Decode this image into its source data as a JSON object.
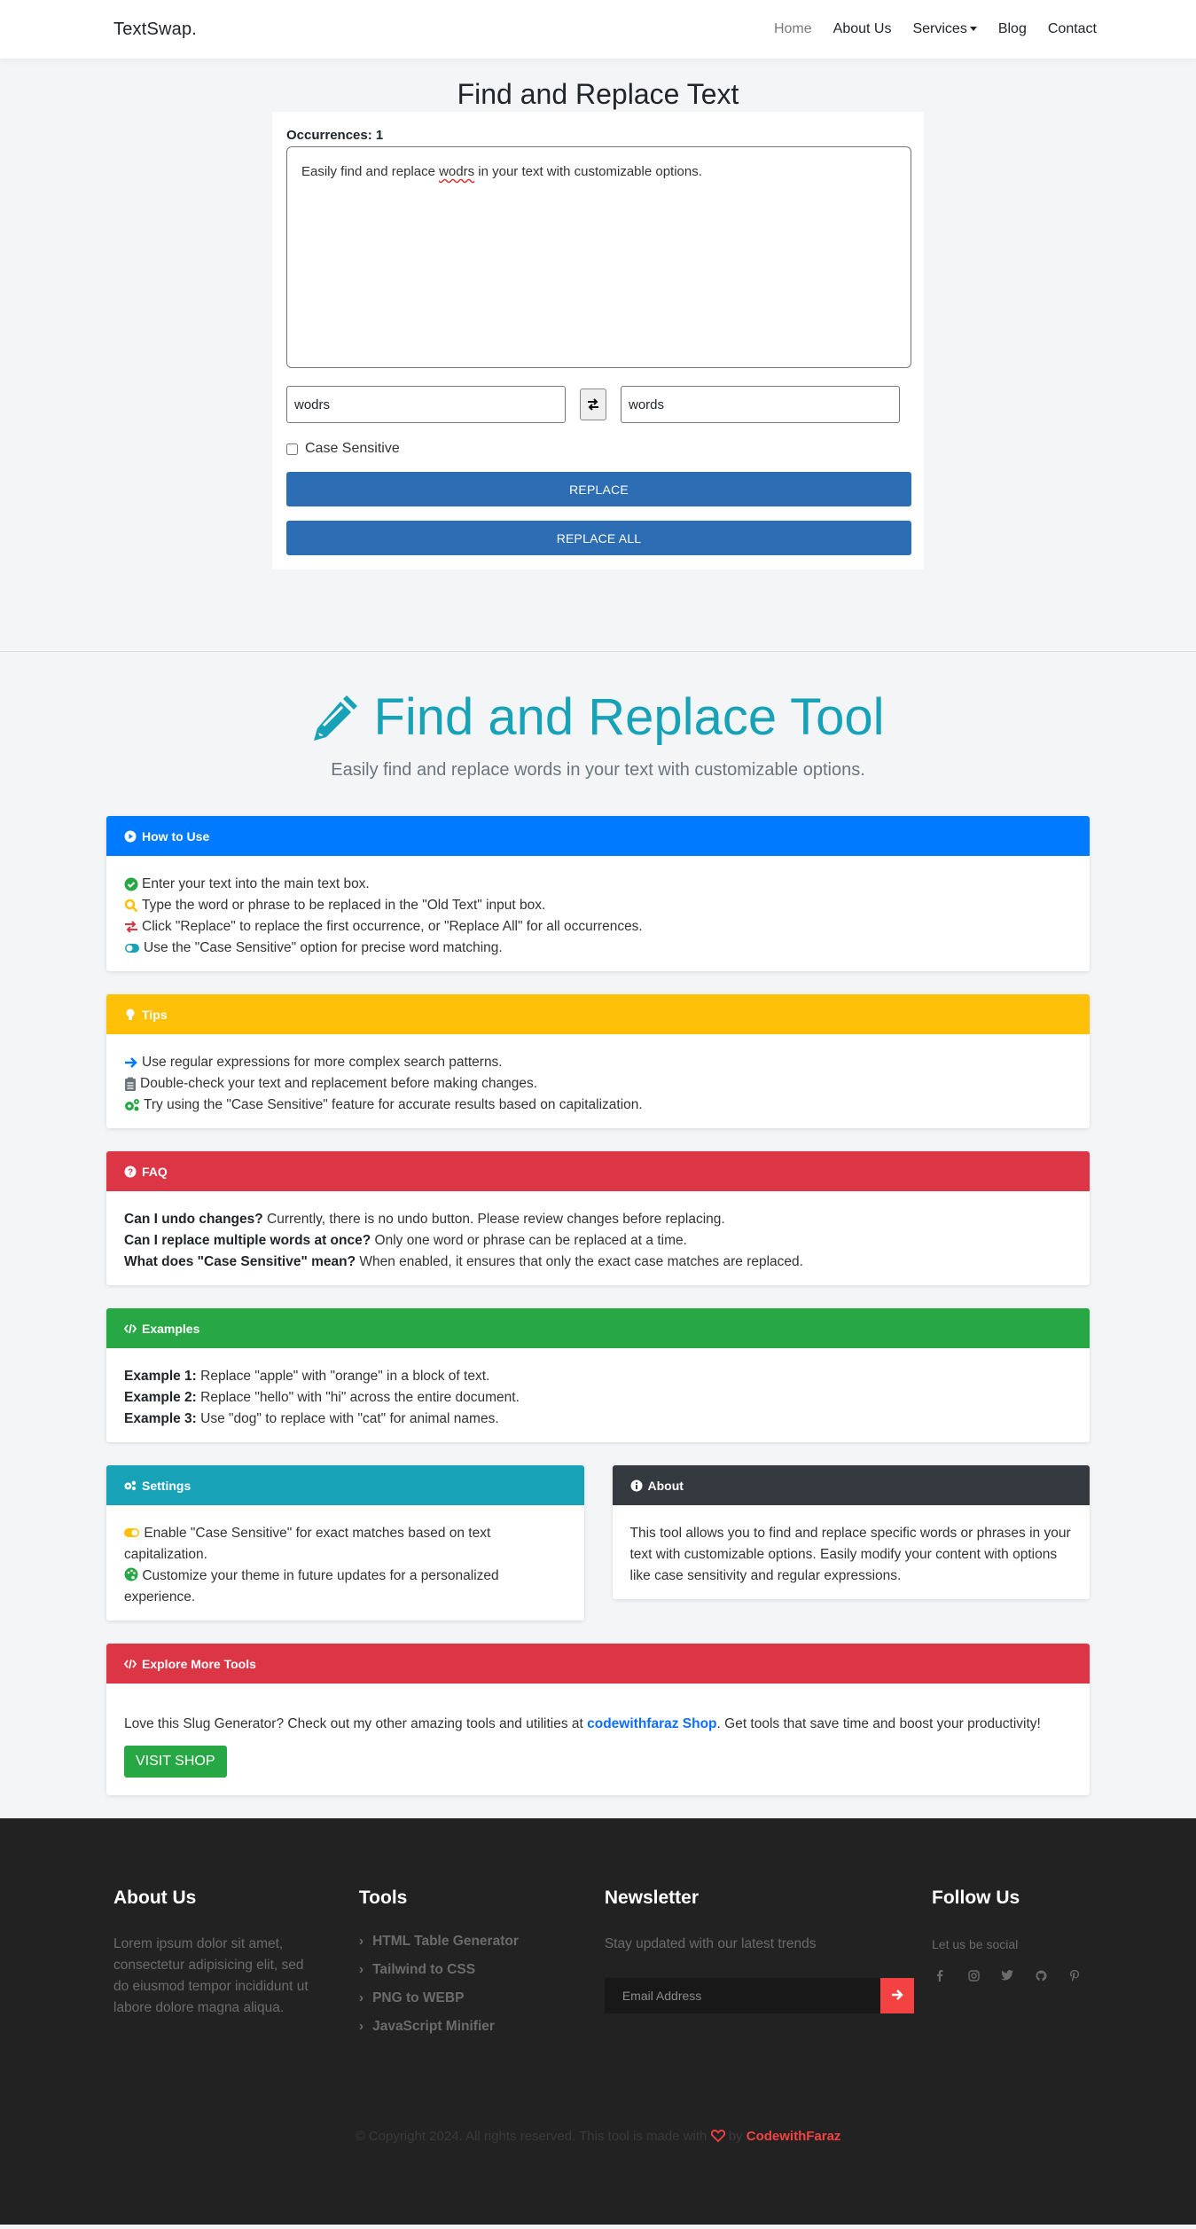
{
  "nav": {
    "brand": "TextSwap.",
    "links": [
      {
        "label": "Home",
        "active": true
      },
      {
        "label": "About Us"
      },
      {
        "label": "Services",
        "dropdown": true
      },
      {
        "label": "Blog"
      },
      {
        "label": "Contact"
      }
    ]
  },
  "tool": {
    "title": "Find and Replace Text",
    "occurrences_label": "Occurrences: 1",
    "text_before": "Easily find and replace ",
    "text_misspelled": "wodrs",
    "text_after": " in your text with customizable options.",
    "find_value": "wodrs",
    "replace_value": "words",
    "swap_icon": "exchange-arrows-icon",
    "case_sensitive_label": "Case Sensitive",
    "case_sensitive_checked": false,
    "replace_label": "REPLACE",
    "replace_all_label": "REPLACE ALL"
  },
  "hero": {
    "icon": "pencil-icon",
    "title": "Find and Replace Tool",
    "subtitle": "Easily find and replace words in your text with customizable options."
  },
  "colors": {
    "primary": "#007bff",
    "warning": "#ffc107",
    "danger": "#dc3545",
    "success": "#28a745",
    "info": "#17a2b8",
    "dark": "#343a40",
    "button_blue": "#2d6db3",
    "footer_bg": "#222222",
    "footer_accent": "#f44242"
  },
  "cards": {
    "how_to_use": {
      "header": "How to Use",
      "icon": "play-circle-icon",
      "items": [
        {
          "icon": "check-circle-icon",
          "text": "Enter your text into the main text box."
        },
        {
          "icon": "search-icon",
          "text": "Type the word or phrase to be replaced in the \"Old Text\" input box."
        },
        {
          "icon": "exchange-icon",
          "text": "Click \"Replace\" to replace the first occurrence, or \"Replace All\" for all occurrences."
        },
        {
          "icon": "toggle-on-icon",
          "text": "Use the \"Case Sensitive\" option for precise word matching."
        }
      ]
    },
    "tips": {
      "header": "Tips",
      "icon": "lightbulb-icon",
      "items": [
        {
          "icon": "arrow-right-icon",
          "text": "Use regular expressions for more complex search patterns."
        },
        {
          "icon": "clipboard-list-icon",
          "text": "Double-check your text and replacement before making changes."
        },
        {
          "icon": "cogs-icon",
          "text": "Try using the \"Case Sensitive\" feature for accurate results based on capitalization."
        }
      ]
    },
    "faq": {
      "header": "FAQ",
      "icon": "question-circle-icon",
      "items": [
        {
          "q": "Can I undo changes?",
          "a": " Currently, there is no undo button. Please review changes before replacing."
        },
        {
          "q": "Can I replace multiple words at once?",
          "a": " Only one word or phrase can be replaced at a time."
        },
        {
          "q": "What does \"Case Sensitive\" mean?",
          "a": " When enabled, it ensures that only the exact case matches are replaced."
        }
      ]
    },
    "examples": {
      "header": "Examples",
      "icon": "code-icon",
      "items": [
        {
          "q": "Example 1:",
          "a": " Replace \"apple\" with \"orange\" in a block of text."
        },
        {
          "q": "Example 2:",
          "a": " Replace \"hello\" with \"hi\" across the entire document."
        },
        {
          "q": "Example 3:",
          "a": " Use \"dog\" to replace with \"cat\" for animal names."
        }
      ]
    },
    "settings": {
      "header": "Settings",
      "icon": "cogs-icon",
      "items": [
        {
          "icon": "toggle-on-icon",
          "text": "Enable \"Case Sensitive\" for exact matches based on text capitalization."
        },
        {
          "icon": "palette-icon",
          "text": "Customize your theme in future updates for a personalized experience."
        }
      ]
    },
    "about": {
      "header": "About",
      "icon": "info-circle-icon",
      "text": "This tool allows you to find and replace specific words or phrases in your text with customizable options. Easily modify your content with options like case sensitivity and regular expressions."
    },
    "explore": {
      "header": "Explore More Tools",
      "icon": "code-icon",
      "text_before": "Love this Slug Generator? Check out my other amazing tools and utilities at ",
      "link_text": "codewithfaraz Shop",
      "text_after": ". Get tools that save time and boost your productivity!",
      "button_label": "VISIT SHOP"
    }
  },
  "footer": {
    "about": {
      "title": "About Us",
      "text": "Lorem ipsum dolor sit amet, consectetur adipisicing elit, sed do eiusmod tempor incididunt ut labore dolore magna aliqua."
    },
    "tools": {
      "title": "Tools",
      "items": [
        "HTML Table Generator",
        "Tailwind to CSS",
        "PNG to WEBP",
        "JavaScript Minifier"
      ]
    },
    "newsletter": {
      "title": "Newsletter",
      "text": "Stay updated with our latest trends",
      "placeholder": "Email Address",
      "submit_icon": "arrow-right-icon"
    },
    "follow": {
      "title": "Follow Us",
      "text": "Let us be social",
      "socials": [
        "facebook-icon",
        "instagram-icon",
        "twitter-icon",
        "github-icon",
        "pinterest-icon"
      ]
    },
    "copyright_text": "© Copyright 2024. All rights reserved. This tool is made with",
    "by_text": "by",
    "brand_link": "CodewithFaraz"
  }
}
